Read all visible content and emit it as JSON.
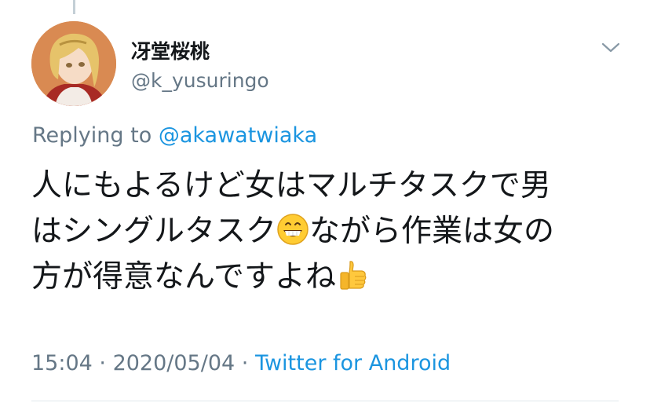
{
  "tweet": {
    "author": {
      "display_name": "冴堂桜桃",
      "handle": "@k_yusuringo"
    },
    "reply": {
      "prefix": "Replying to ",
      "mention": "@akawatwiaka"
    },
    "body": {
      "line1": "人にもよるけど女はマルチタスクで男",
      "line2a": "はシングルタスク",
      "line2b": "ながら作業は女の",
      "line3": "方が得意なんですよね"
    },
    "meta": {
      "time": "15:04",
      "separator": " · ",
      "date": "2020/05/04",
      "source": "Twitter for Android"
    }
  },
  "icons": {
    "caret": "chevron-down-icon",
    "emoji_1": "grinning-face-emoji",
    "emoji_2": "thumbs-up-emoji"
  },
  "colors": {
    "text": "#14171a",
    "secondary": "#657786",
    "link": "#1b95e0",
    "divider": "#e1e8ed"
  }
}
